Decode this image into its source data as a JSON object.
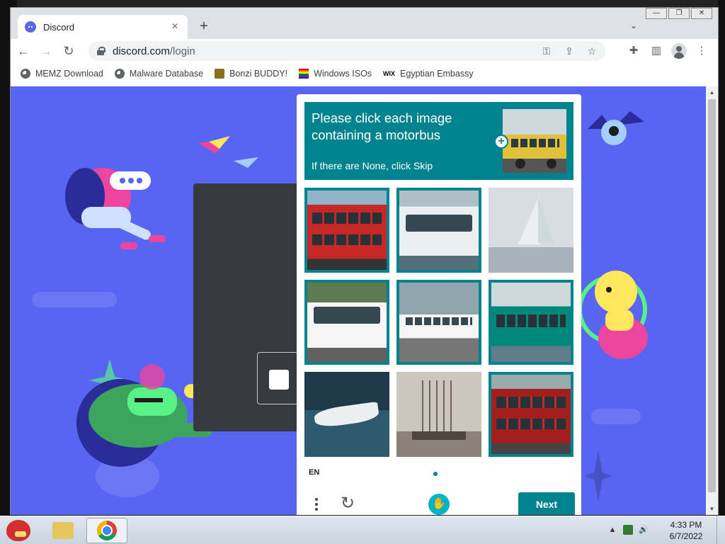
{
  "browser": {
    "tab_title": "Discord",
    "url_host": "discord.com",
    "url_path": "/login",
    "window_controls": [
      "minimize",
      "restore",
      "close"
    ]
  },
  "bookmarks": [
    {
      "label": "MEMZ Download",
      "icon": "globe-icon"
    },
    {
      "label": "Malware Database",
      "icon": "globe-icon"
    },
    {
      "label": "Bonzi BUDDY!",
      "icon": "bonzi-icon"
    },
    {
      "label": "Windows ISOs",
      "icon": "flag-icon"
    },
    {
      "label": "Egyptian Embassy",
      "icon": "wix-icon"
    }
  ],
  "captcha": {
    "prompt": "Please click each image containing a motorbus",
    "subprompt": "If there are None, click Skip",
    "language": "EN",
    "next_label": "Next",
    "tiles": [
      {
        "subject": "red double-decker bus",
        "selected": true
      },
      {
        "subject": "white coach bus",
        "selected": true
      },
      {
        "subject": "sailboat",
        "selected": false
      },
      {
        "subject": "white bus",
        "selected": true
      },
      {
        "subject": "white articulated bus",
        "selected": true
      },
      {
        "subject": "teal bus",
        "selected": true
      },
      {
        "subject": "speedboat",
        "selected": false
      },
      {
        "subject": "old sailing ship",
        "selected": false
      },
      {
        "subject": "red double-decker bus",
        "selected": true
      }
    ],
    "accent_color": "#00838f"
  },
  "page": {
    "background_color": "#5865f2"
  },
  "taskbar": {
    "apps": [
      "angry-birds",
      "folder",
      "chrome"
    ],
    "time": "4:33 PM",
    "date": "6/7/2022"
  }
}
